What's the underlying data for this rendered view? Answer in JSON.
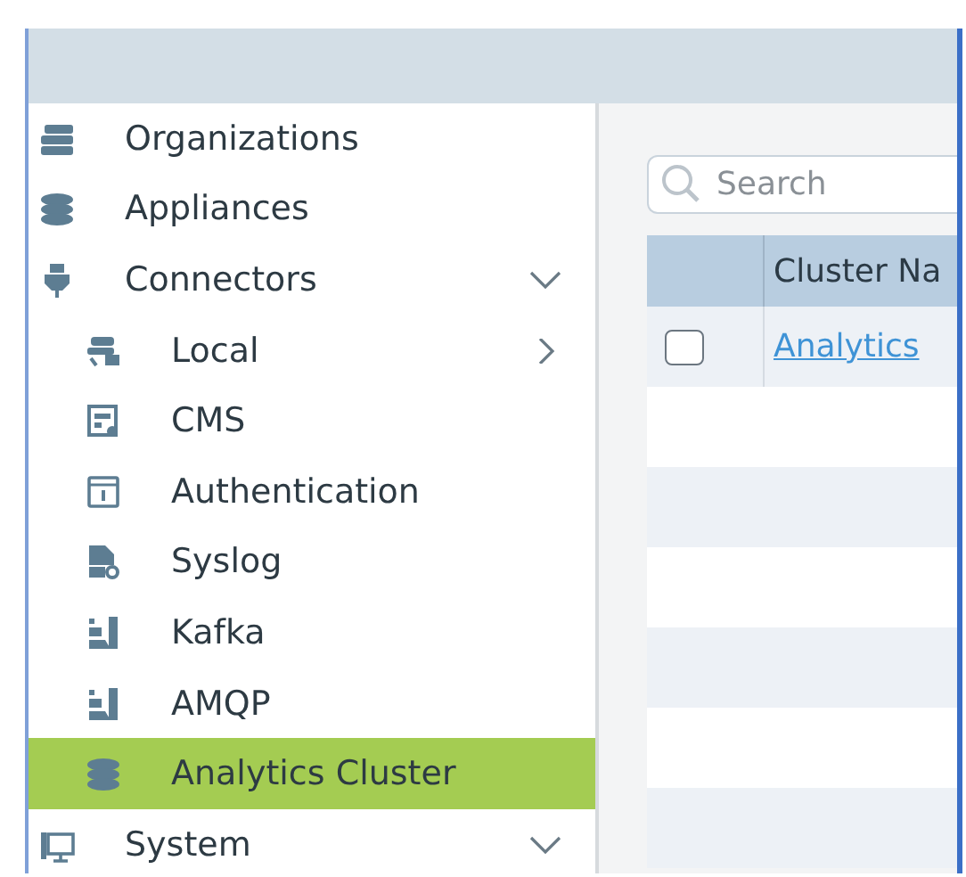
{
  "sidebar": {
    "items": [
      {
        "label": "Organizations",
        "kind": "servers",
        "selected": false
      },
      {
        "label": "Appliances",
        "kind": "stack",
        "selected": false
      },
      {
        "label": "Connectors",
        "kind": "plug",
        "selected": false,
        "expanded": true,
        "children": [
          {
            "label": "Local",
            "kind": "mail-server",
            "selected": false,
            "expanded": false
          },
          {
            "label": "CMS",
            "kind": "form",
            "selected": false
          },
          {
            "label": "Authentication",
            "kind": "lock-box",
            "selected": false
          },
          {
            "label": "Syslog",
            "kind": "file-gear",
            "selected": false
          },
          {
            "label": "Kafka",
            "kind": "bars",
            "selected": false
          },
          {
            "label": "AMQP",
            "kind": "bars",
            "selected": false
          },
          {
            "label": "Analytics Cluster",
            "kind": "stack",
            "selected": true
          }
        ]
      },
      {
        "label": "System",
        "kind": "monitor",
        "selected": false,
        "expanded": true
      }
    ]
  },
  "search": {
    "placeholder": "Search"
  },
  "table": {
    "columns": [
      "Cluster Na"
    ],
    "rows": [
      {
        "checked": false,
        "cluster_name": "Analytics"
      }
    ]
  }
}
